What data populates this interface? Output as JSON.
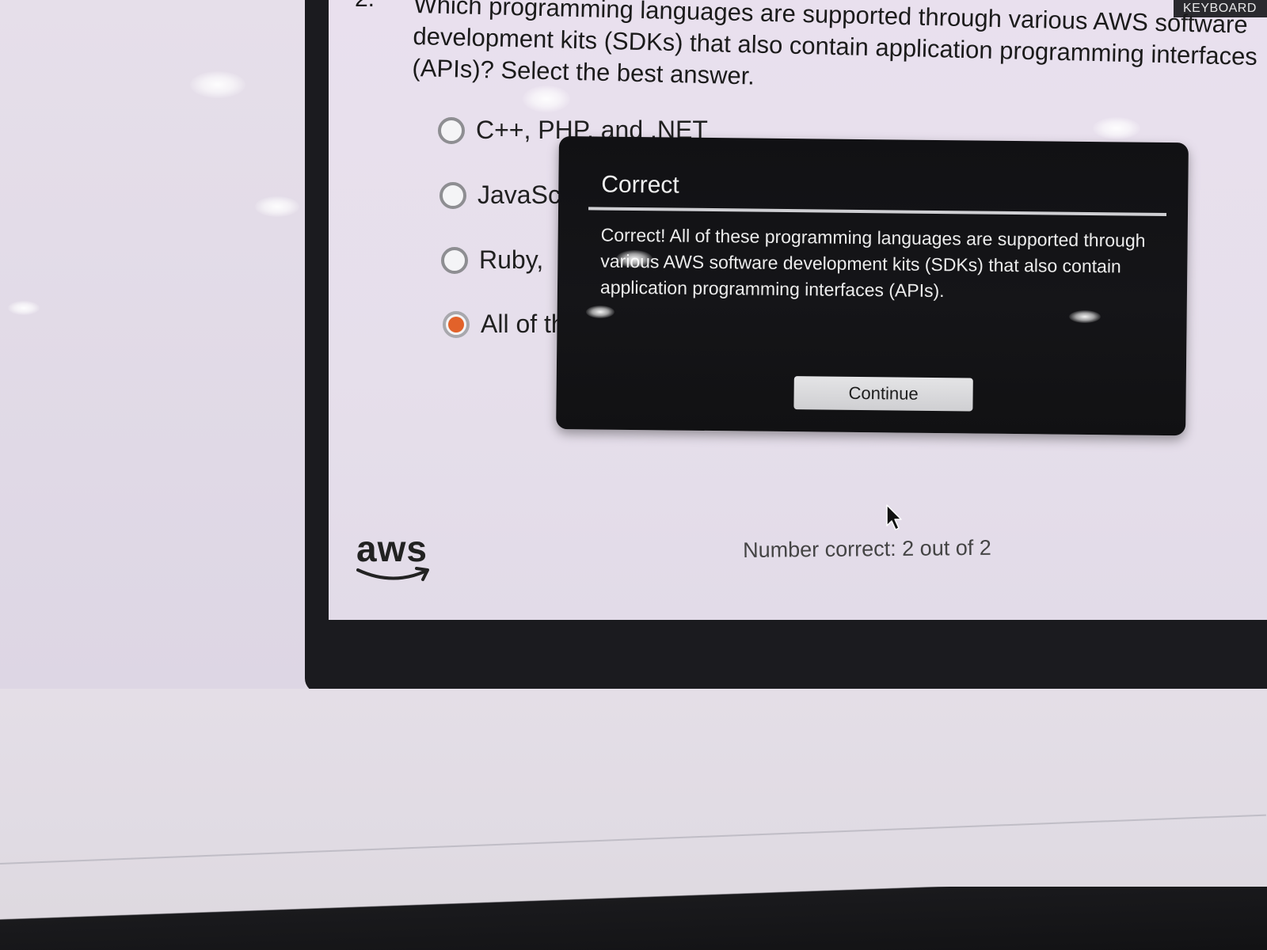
{
  "header": {
    "keyboard_label": "KEYBOARD"
  },
  "question": {
    "number": "2.",
    "text": "Which programming languages are supported through various AWS software development kits (SDKs) that also contain application programming interfaces (APIs)? Select the best answer."
  },
  "options": [
    {
      "label": "C++, PHP, and .NET",
      "selected": false
    },
    {
      "label": "JavaScript",
      "selected": false
    },
    {
      "label": "Ruby, ",
      "selected": false
    },
    {
      "label": "All of the above",
      "selected": true
    }
  ],
  "modal": {
    "title": "Correct",
    "body": "Correct! All of these programming languages are supported through various AWS software development kits (SDKs) that also contain application programming interfaces (APIs).",
    "continue_label": "Continue"
  },
  "footer": {
    "logo_text": "aws",
    "score_text": "Number correct: 2 out of 2"
  },
  "colors": {
    "accent": "#e2622a",
    "modal_bg": "#131316"
  },
  "icons": {
    "cursor": "mouse-pointer-icon",
    "logo_smile": "aws-smile-arrow-icon"
  }
}
